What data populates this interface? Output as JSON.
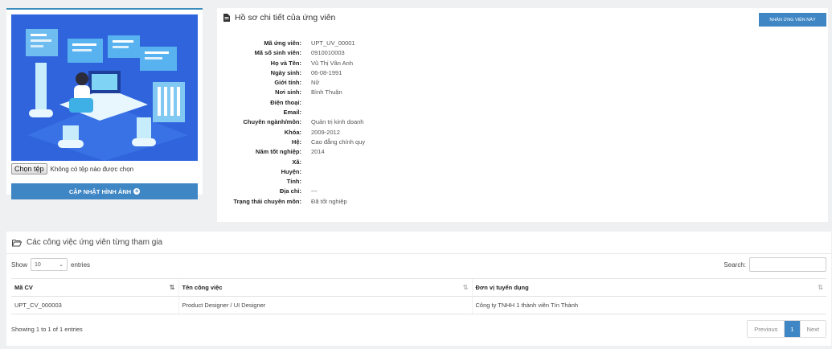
{
  "photo_panel": {
    "file_button_label": "Chọn tệp",
    "file_status": "Không có tệp nào được chọn",
    "update_button_label": "CẬP NHẬT HÌNH ẢNH"
  },
  "profile": {
    "title": "Hồ sơ chi tiết của ứng viên",
    "accept_button_label": "NHẬN ỨNG VIÊN NÀY",
    "rows": [
      {
        "label": "Mã ứng viên:",
        "value": "UPT_UV_00001"
      },
      {
        "label": "Mã số sinh viên:",
        "value": "0910010003"
      },
      {
        "label": "Họ và Tên:",
        "value": "Vũ Thị Vân Anh"
      },
      {
        "label": "Ngày sinh:",
        "value": "06-08-1991"
      },
      {
        "label": "Giới tính:",
        "value": "Nữ"
      },
      {
        "label": "Nơi sinh:",
        "value": "Bình Thuận"
      },
      {
        "label": "Điện thoại:",
        "value": ""
      },
      {
        "label": "Email:",
        "value": ""
      },
      {
        "label": "Chuyên ngành/môn:",
        "value": "Quản trị kinh doanh"
      },
      {
        "label": "Khóa:",
        "value": "2009-2012"
      },
      {
        "label": "Hệ:",
        "value": "Cao đẳng chính quy"
      },
      {
        "label": "Năm tốt nghiệp:",
        "value": "2014"
      },
      {
        "label": "Xã:",
        "value": ""
      },
      {
        "label": "Huyện:",
        "value": ""
      },
      {
        "label": "Tỉnh:",
        "value": ""
      },
      {
        "label": "Địa chỉ:",
        "value": "---"
      },
      {
        "label": "Trạng thái chuyên môn:",
        "value": "Đã tốt nghiệp"
      }
    ]
  },
  "jobs": {
    "title": "Các công việc ứng viên từng tham gia",
    "show_label": "Show",
    "entries_value": "10",
    "entries_label": "entries",
    "search_label": "Search:",
    "columns": [
      "Mã CV",
      "Tên công việc",
      "Đơn vị tuyển dụng"
    ],
    "rows": [
      [
        "UPT_CV_000003",
        "Product Designer / UI Designer",
        "Công ty TNHH 1 thành viên Tín Thành"
      ]
    ],
    "info": "Showing 1 to 1 of 1 entries",
    "pagination": {
      "previous": "Previous",
      "current": "1",
      "next": "Next"
    }
  },
  "colors": {
    "accent": "#3e86c4",
    "background": "#eef0f2"
  },
  "icons": [
    "file-icon",
    "folder-open-icon",
    "plus-circle-icon",
    "sort-icon"
  ]
}
